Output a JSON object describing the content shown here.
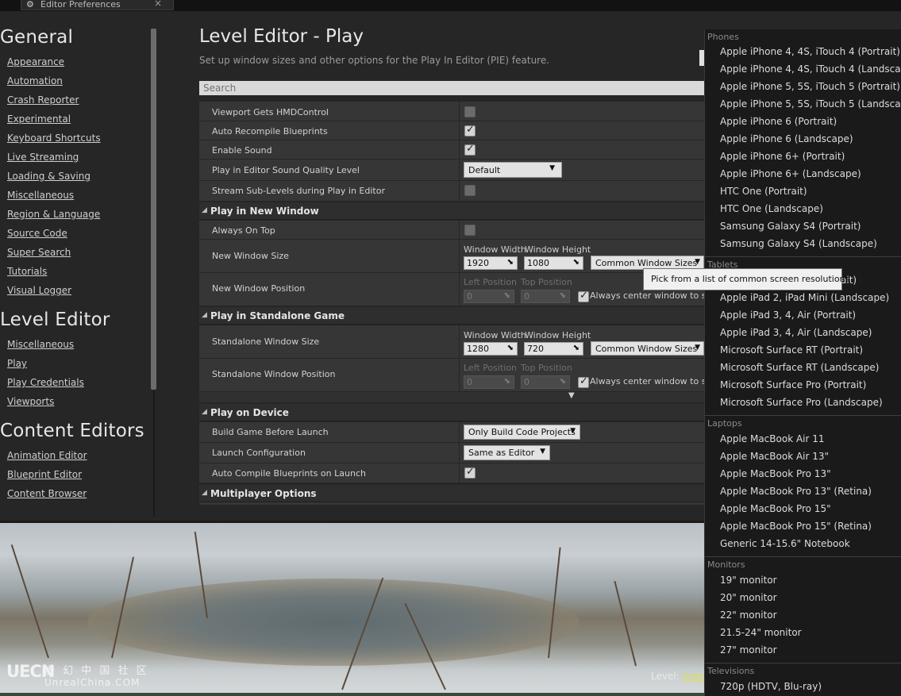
{
  "tab": {
    "title": "Editor Preferences",
    "close": "×"
  },
  "nav": {
    "general_heading": "General",
    "general_items": [
      "Appearance",
      "Automation",
      "Crash Reporter",
      "Experimental",
      "Keyboard Shortcuts",
      "Live Streaming",
      "Loading & Saving",
      "Miscellaneous",
      "Region & Language",
      "Source Code",
      "Super Search",
      "Tutorials",
      "Visual Logger"
    ],
    "level_heading": "Level Editor",
    "level_items": [
      "Miscellaneous",
      "Play",
      "Play Credentials",
      "Viewports"
    ],
    "content_heading": "Content Editors",
    "content_items": [
      "Animation Editor",
      "Blueprint Editor",
      "Content Browser"
    ]
  },
  "main": {
    "title": "Level Editor - Play",
    "subtitle": "Set up window sizes and other options for the Play In Editor (PIE) feature.",
    "search_placeholder": "Search",
    "rows": {
      "hmd": "Viewport Gets HMDControl",
      "recompile": "Auto Recompile Blueprints",
      "sound": "Enable Sound",
      "sound_quality": "Play in Editor Sound Quality Level",
      "sound_quality_value": "Default",
      "stream": "Stream Sub-Levels during Play in Editor"
    },
    "new_window": {
      "header": "Play in New Window",
      "always_on_top": "Always On Top",
      "size_label": "New Window Size",
      "width_label": "Window Width",
      "height_label": "Window Height",
      "width": "1920",
      "height": "1080",
      "common_sizes": "Common Window Sizes",
      "position_label": "New Window Position",
      "left_label": "Left Position",
      "top_label": "Top Position",
      "left": "0",
      "top": "0",
      "always_center": "Always center window to scr"
    },
    "standalone": {
      "header": "Play in Standalone Game",
      "size_label": "Standalone Window Size",
      "width_label": "Window Width",
      "height_label": "Window Height",
      "width": "1280",
      "height": "720",
      "common_sizes": "Common Window Sizes",
      "position_label": "Standalone Window Position",
      "left_label": "Left Position",
      "top_label": "Top Position",
      "left": "0",
      "top": "0",
      "always_center": "Always center window to scr"
    },
    "device": {
      "header": "Play on Device",
      "build_label": "Build Game Before Launch",
      "build_value": "Only Build Code Projects",
      "launch_label": "Launch Configuration",
      "launch_value": "Same as Editor",
      "auto_compile": "Auto Compile Blueprints on Launch"
    },
    "multiplayer_header": "Multiplayer Options"
  },
  "menu": {
    "phones_label": "Phones",
    "phones": [
      "Apple iPhone 4, 4S, iTouch 4 (Portrait)",
      "Apple iPhone 4, 4S, iTouch 4 (Landscape)",
      "Apple iPhone 5, 5S, iTouch 5 (Portrait)",
      "Apple iPhone 5, 5S, iTouch 5 (Landscape)",
      "Apple iPhone 6 (Portrait)",
      "Apple iPhone 6 (Landscape)",
      "Apple iPhone 6+ (Portrait)",
      "Apple iPhone 6+ (Landscape)",
      "HTC One (Portrait)",
      "HTC One (Landscape)",
      "Samsung Galaxy S4 (Portrait)",
      "Samsung Galaxy S4 (Landscape)"
    ],
    "tablets_label": "Tablets",
    "tablets": [
      "ait)",
      "Apple iPad 2, iPad Mini (Landscape)",
      "Apple iPad 3, 4, Air (Portrait)",
      "Apple iPad 3, 4, Air (Landscape)",
      "Microsoft Surface RT (Portrait)",
      "Microsoft Surface RT (Landscape)",
      "Microsoft Surface Pro (Portrait)",
      "Microsoft Surface Pro (Landscape)"
    ],
    "laptops_label": "Laptops",
    "laptops": [
      "Apple MacBook Air 11",
      "Apple MacBook Air 13\"",
      "Apple MacBook Pro 13\"",
      "Apple MacBook Pro 13\" (Retina)",
      "Apple MacBook Pro 15\"",
      "Apple MacBook Pro 15\" (Retina)",
      "Generic 14-15.6\" Notebook"
    ],
    "monitors_label": "Monitors",
    "monitors": [
      "19\" monitor",
      "20\" monitor",
      "22\" monitor",
      "21.5-24\" monitor",
      "27\" monitor"
    ],
    "tv_label": "Televisions",
    "tv": [
      "720p (HDTV, Blu-ray)"
    ]
  },
  "tooltip": "Pick from a list of common screen resolutions",
  "viewport": {
    "logo_mark": "UECN",
    "logo_cn": "虚 幻 中 国 社 区",
    "logo_en": "UnrealChina.COM",
    "level_label": "Level:",
    "level_name": "map_"
  }
}
